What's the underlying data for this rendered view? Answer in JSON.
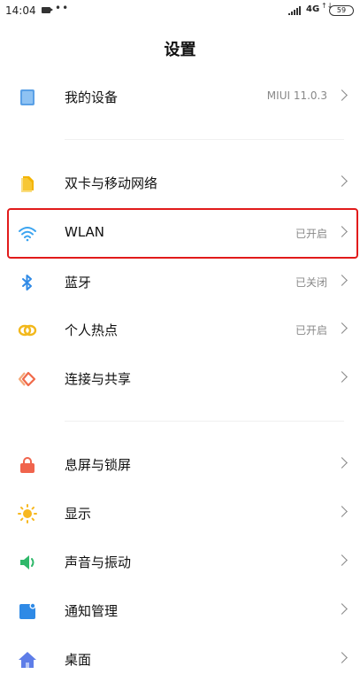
{
  "status_bar": {
    "time": "14:04",
    "dots": "••",
    "network": "4G",
    "network_arrows": "↑↓",
    "battery": "59"
  },
  "header": {
    "title": "设置"
  },
  "sections": [
    {
      "items": [
        {
          "label": "我的设备",
          "value": "MIUI 11.0.3",
          "icon": "phone-device-icon",
          "icon_color": "#5aa0e6"
        }
      ]
    },
    {
      "items": [
        {
          "label": "双卡与移动网络",
          "value": "",
          "icon": "sim-card-icon",
          "icon_color": "#f4b400"
        },
        {
          "label": "WLAN",
          "value": "已开启",
          "icon": "wifi-icon",
          "icon_color": "#3ba4f0",
          "highlighted": true
        },
        {
          "label": "蓝牙",
          "value": "已关闭",
          "icon": "bluetooth-icon",
          "icon_color": "#2f8ae6"
        },
        {
          "label": "个人热点",
          "value": "已开启",
          "icon": "hotspot-icon",
          "icon_color": "#f2b81c"
        },
        {
          "label": "连接与共享",
          "value": "",
          "icon": "share-icon",
          "icon_color": "#f06a4a"
        }
      ]
    },
    {
      "items": [
        {
          "label": "息屏与锁屏",
          "value": "",
          "icon": "lock-icon",
          "icon_color": "#f0644d"
        },
        {
          "label": "显示",
          "value": "",
          "icon": "sun-icon",
          "icon_color": "#f7b820"
        },
        {
          "label": "声音与振动",
          "value": "",
          "icon": "speaker-icon",
          "icon_color": "#2fb86a"
        },
        {
          "label": "通知管理",
          "value": "",
          "icon": "notification-icon",
          "icon_color": "#2f8ae6"
        },
        {
          "label": "桌面",
          "value": "",
          "icon": "home-icon",
          "icon_color": "#5e7de8"
        }
      ]
    }
  ],
  "highlight_color": "#e11b1b"
}
